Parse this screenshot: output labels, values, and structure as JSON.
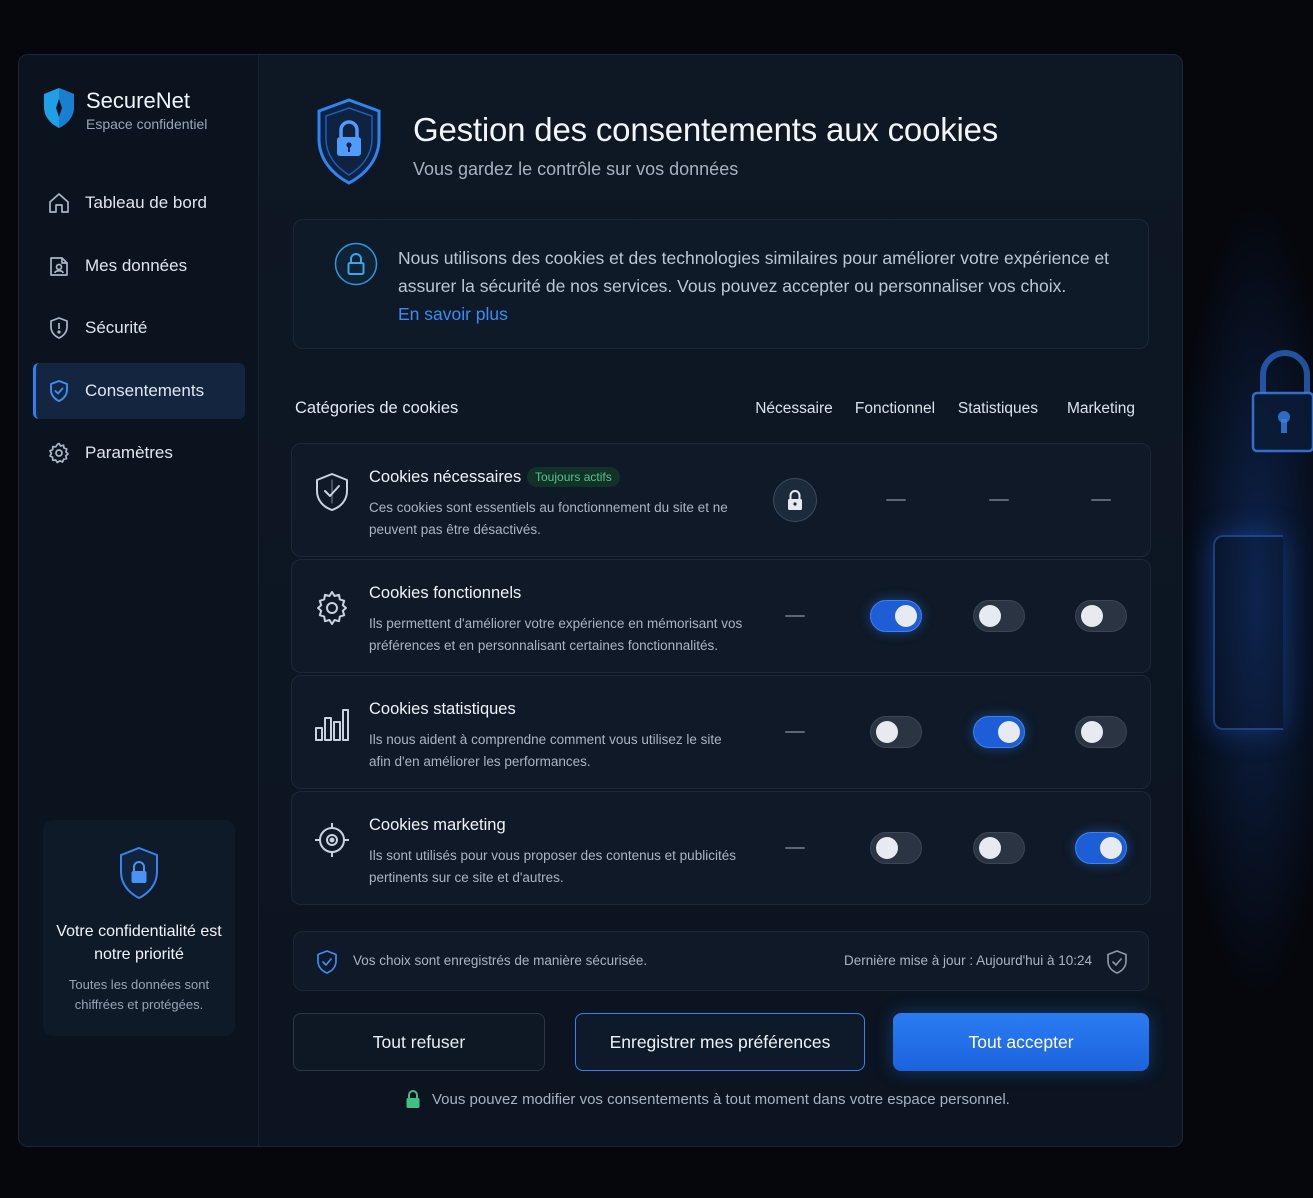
{
  "brand": {
    "name": "SecureNet",
    "subtitle": "Espace confidentiel"
  },
  "sidebar": {
    "items": [
      {
        "label": "Tableau de bord",
        "icon": "home-icon",
        "active": false
      },
      {
        "label": "Mes données",
        "icon": "data-icon",
        "active": false
      },
      {
        "label": "Sécurité",
        "icon": "shield-icon",
        "active": false
      },
      {
        "label": "Consentements",
        "icon": "shield-check-icon",
        "active": true
      },
      {
        "label": "Paramètres",
        "icon": "gear-icon",
        "active": false
      }
    ],
    "promo": {
      "title": "Votre confidentialité est notre priorité",
      "text": "Toutes les données sont chiffrées et protégées."
    }
  },
  "header": {
    "title": "Gestion des consentements aux cookies",
    "subtitle": "Vous gardez le contrôle sur vos données"
  },
  "info": {
    "text": "Nous utilisons des cookies et des technologies similaires pour améliorer votre expérience et assurer la sécurité de nos services. Vous pouvez accepter ou personnaliser vos choix.",
    "link": "En savoir plus"
  },
  "table": {
    "header": "Catégories de cookies",
    "columns": [
      "Nécessaire",
      "Fonctionnel",
      "Statistiques",
      "Marketing"
    ],
    "rows": [
      {
        "title": "Cookies nécessaires",
        "badge": "Toujours actifs",
        "desc": "Ces cookies sont essentiels au fonctionnement du site et ne peuvent pas être désactivés.",
        "icon": "shield-icon",
        "cells": [
          "lock",
          "dash",
          "dash",
          "dash"
        ]
      },
      {
        "title": "Cookies fonctionnels",
        "badge": "",
        "desc": "Ils permettent d'améliorer votre expérience en mémorisant vos préférences et en personnalisant certaines fonctionnalités.",
        "icon": "gear-icon",
        "cells": [
          "dash",
          "on",
          "off",
          "off"
        ]
      },
      {
        "title": "Cookies statistiques",
        "badge": "",
        "desc": "Ils nous aident à comprendne comment vous utilisez le site afin d'en améliorer les performances.",
        "icon": "bar-chart-icon",
        "cells": [
          "dash",
          "off",
          "on",
          "off"
        ]
      },
      {
        "title": "Cookies marketing",
        "badge": "",
        "desc": "Ils sont utilisés pour vous proposer des contenus et publicités pertinents sur ce site et d'autres.",
        "icon": "target-icon",
        "cells": [
          "dash",
          "off",
          "off",
          "on"
        ]
      }
    ]
  },
  "status": {
    "left": "Vos choix sont enregistrés de manière sécurisée.",
    "right": "Dernière mise à jour : Aujourd'hui à 10:24"
  },
  "actions": {
    "refuse": "Tout refuser",
    "save": "Enregistrer mes préférences",
    "accept": "Tout accepter"
  },
  "footer": {
    "note": "Vous pouvez modifier vos consentements à tout moment dans votre espace personnel."
  },
  "colors": {
    "accent": "#2d7ff0",
    "background": "#05070c",
    "panel": "#0e1724",
    "success": "#4fc78e"
  }
}
